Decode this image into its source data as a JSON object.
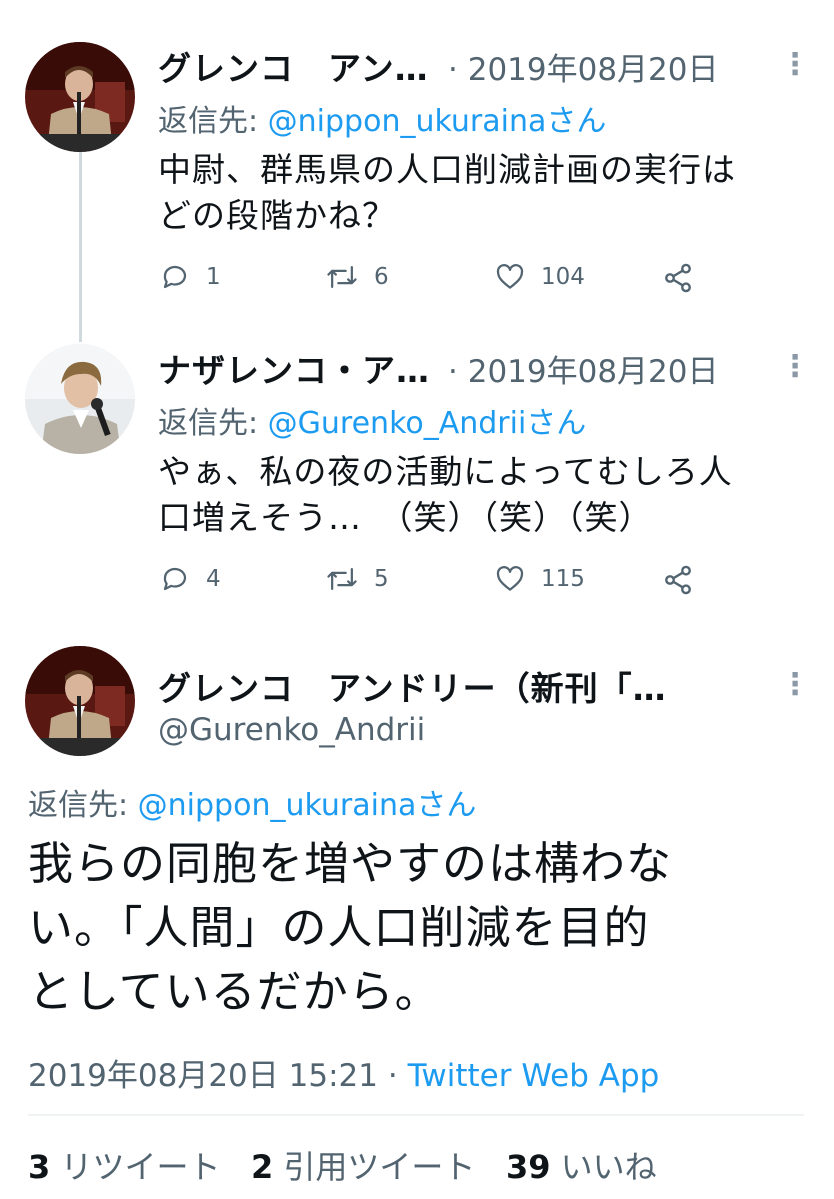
{
  "tweets": [
    {
      "author_name": "グレンコ　アン…",
      "date": "2019年08月20日",
      "separator": "·",
      "reply_label": "返信先:",
      "reply_to": "@nippon_ukurainaさん",
      "text_lines": [
        "中尉、群馬県の人口削減計画の実行は",
        "どの段階かね？"
      ],
      "replies": "1",
      "retweets": "6",
      "likes": "104"
    },
    {
      "author_name": "ナザレンコ・ア…",
      "date": "2019年08月20日",
      "separator": "·",
      "reply_label": "返信先:",
      "reply_to": "@Gurenko_Andriiさん",
      "text_lines": [
        "やぁ、私の夜の活動によってむしろ人",
        "口増えそう…　（笑）（笑）（笑）"
      ],
      "replies": "4",
      "retweets": "5",
      "likes": "115"
    }
  ],
  "main_tweet": {
    "author_name": "グレンコ　アンドリー（新刊「…",
    "handle": "@Gurenko_Andrii",
    "reply_label": "返信先:",
    "reply_to": "@nippon_ukurainaさん",
    "text_lines": [
      "我らの同胞を増やすのは構わな",
      "い。「人間」の人口削減を目的",
      "としているだから。"
    ],
    "timestamp": "2019年08月20日 15:21",
    "separator": "·",
    "source_app": "Twitter Web App",
    "stats": {
      "retweets_count": "3",
      "retweets_label": "リツイート",
      "quotes_count": "2",
      "quotes_label": "引用ツイート",
      "likes_count": "39",
      "likes_label": "いいね"
    }
  },
  "more_glyph": "⋮",
  "colors": {
    "link": "#1d9bf0",
    "secondary_text": "#536471",
    "thread_line": "#cfd9de"
  }
}
